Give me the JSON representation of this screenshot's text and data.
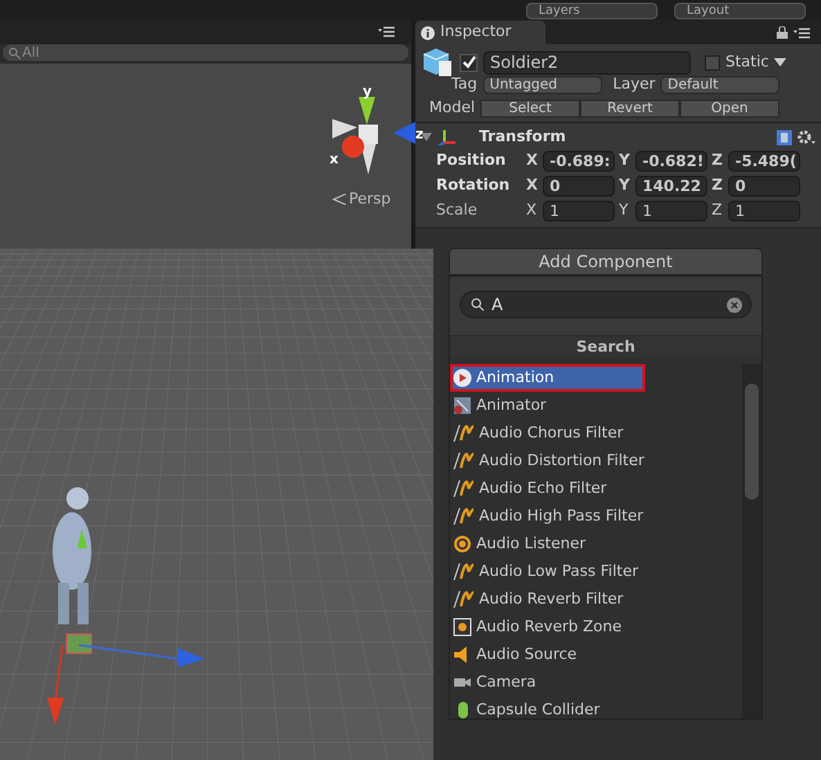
{
  "toolbar": {
    "buttons": [
      "Layers",
      "Layout"
    ]
  },
  "scene": {
    "search": {
      "placeholder": "All"
    },
    "gizmo": {
      "labels": [
        "y",
        "z",
        "x"
      ]
    },
    "projection": "Persp"
  },
  "inspector": {
    "tab": "Inspector",
    "object": {
      "active": true,
      "name": "Soldier2",
      "static_label": "Static",
      "static": false
    },
    "tag": {
      "label": "Tag",
      "value": "Untagged"
    },
    "layer": {
      "label": "Layer",
      "value": "Default"
    },
    "model": {
      "label": "Model",
      "buttons": [
        "Select",
        "Revert",
        "Open"
      ]
    },
    "transform": {
      "title": "Transform",
      "expanded": true,
      "rows": [
        {
          "label": "Position",
          "bold": true,
          "axes": [
            "X",
            "Y",
            "Z"
          ],
          "values": [
            "-0.689:",
            "-0.682!",
            "-5.489("
          ]
        },
        {
          "label": "Rotation",
          "bold": true,
          "axes": [
            "X",
            "Y",
            "Z"
          ],
          "values": [
            "0",
            "140.22",
            "0"
          ]
        },
        {
          "label": "Scale",
          "bold": false,
          "axes": [
            "X",
            "Y",
            "Z"
          ],
          "values": [
            "1",
            "1",
            "1"
          ]
        }
      ]
    },
    "add_component": {
      "button": "Add Component",
      "search_value": "A",
      "header": "Search",
      "items": [
        {
          "label": "Animation",
          "kind": "animation",
          "selected": true
        },
        {
          "label": "Animator",
          "kind": "animator",
          "selected": false
        },
        {
          "label": "Audio Chorus Filter",
          "kind": "filter",
          "selected": false
        },
        {
          "label": "Audio Distortion Filter",
          "kind": "filter",
          "selected": false
        },
        {
          "label": "Audio Echo Filter",
          "kind": "filter",
          "selected": false
        },
        {
          "label": "Audio High Pass Filter",
          "kind": "filter",
          "selected": false
        },
        {
          "label": "Audio Listener",
          "kind": "listener",
          "selected": false
        },
        {
          "label": "Audio Low Pass Filter",
          "kind": "filter",
          "selected": false
        },
        {
          "label": "Audio Reverb Filter",
          "kind": "filter",
          "selected": false
        },
        {
          "label": "Audio Reverb Zone",
          "kind": "zone",
          "selected": false
        },
        {
          "label": "Audio Source",
          "kind": "source",
          "selected": false
        },
        {
          "label": "Camera",
          "kind": "camera",
          "selected": false
        },
        {
          "label": "Capsule Collider",
          "kind": "collider",
          "selected": false
        }
      ]
    }
  }
}
